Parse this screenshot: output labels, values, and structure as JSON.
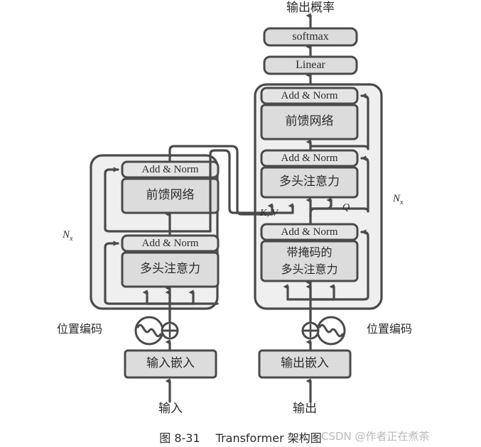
{
  "figure": {
    "caption_number": "图 8-31",
    "caption_title": "Transformer 架构图",
    "watermark": "CSDN @作者正在煮茶"
  },
  "top": {
    "output_probabilities": "输出概率",
    "softmax": "softmax",
    "linear": "Linear"
  },
  "encoder": {
    "repeat_label": "Nx",
    "repeat_base": "N",
    "repeat_sub": "x",
    "add_norm_top": "Add & Norm",
    "feed_forward": "前馈网络",
    "add_norm_bottom": "Add & Norm",
    "multi_head_attention": "多头注意力",
    "positional_encoding": "位置编码",
    "input_embedding": "输入嵌入",
    "input": "输入"
  },
  "decoder": {
    "repeat_label": "Nx",
    "repeat_base": "N",
    "repeat_sub": "x",
    "add_norm_top": "Add & Norm",
    "feed_forward": "前馈网络",
    "add_norm_mid": "Add & Norm",
    "cross_attention": "多头注意力",
    "kv_label": "K, V",
    "q_label": "Q",
    "add_norm_bottom": "Add & Norm",
    "masked_attention_line1": "带掩码的",
    "masked_attention_line2": "多头注意力",
    "positional_encoding": "位置编码",
    "output_embedding": "输出嵌入",
    "output": "输出"
  },
  "style": {
    "line_color": "#4a4a4a",
    "box_fill": "#dcdcdc",
    "container_fill": "#efefef",
    "addnorm_fill": "#e4e4e4",
    "text_color": "#2b2b2b",
    "watermark_color": "#b9b9b9"
  }
}
